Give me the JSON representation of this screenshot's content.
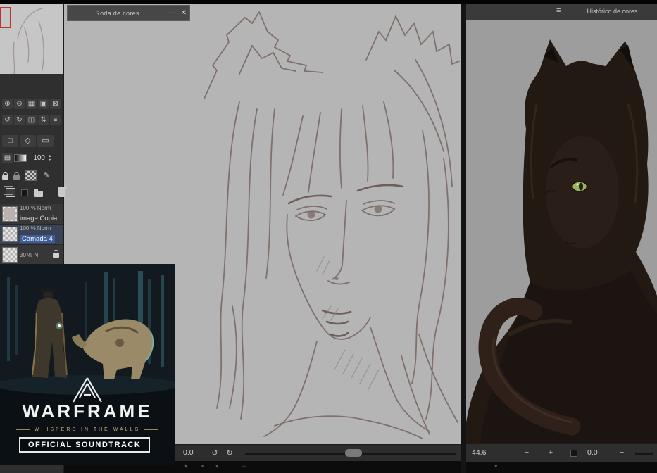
{
  "colors": {
    "selection_accent": "#3d5c9a",
    "canvas_bg": "#b5b5b5",
    "right_canvas_bg": "#9d9d9d",
    "eye_green": "#9db05e",
    "navigator_view_rect": "#c23030"
  },
  "panels": {
    "color_wheel": {
      "title": "Roda de cores"
    },
    "color_history": {
      "title": "Histórico de cores"
    }
  },
  "icons": {
    "zoom_in": "⊕",
    "zoom_out": "⊖",
    "fit_view": "▦",
    "actual_size": "▣",
    "close_view": "⊠",
    "rotate_ccw": "↺",
    "rotate_cw": "↻",
    "flip_h": "◫",
    "flip_v": "⇅",
    "view_menu": "≡",
    "select_tool": "□",
    "lasso_tool": "◇",
    "marquee_tool": "▭",
    "blend_mode": "▤",
    "stepper_up": "▲",
    "stepper_down": "▼",
    "pen_tool": "✎",
    "minimize": "—",
    "close": "✕",
    "menu": "≡",
    "chevron_down": "▾",
    "dot": "▪",
    "minus": "−",
    "plus": "+"
  },
  "tool_opacity": {
    "value": "100"
  },
  "layers": {
    "rows": [
      {
        "meta": "100 % Norm",
        "name": "image Copiar",
        "selected": false,
        "locked": false
      },
      {
        "meta": "100 % Norm",
        "name": "Camada 4",
        "selected": true,
        "locked": false
      },
      {
        "meta": "30 % N",
        "name": "",
        "selected": false,
        "locked": true
      }
    ]
  },
  "status_center": {
    "rotation": "0.0"
  },
  "status_right": {
    "zoom": "44.6",
    "rotation": "0.0"
  },
  "album": {
    "title": "WARFRAME",
    "subtitle": "WHISPERS IN THE WALLS",
    "badge": "OFFICIAL SOUNDTRACK"
  }
}
